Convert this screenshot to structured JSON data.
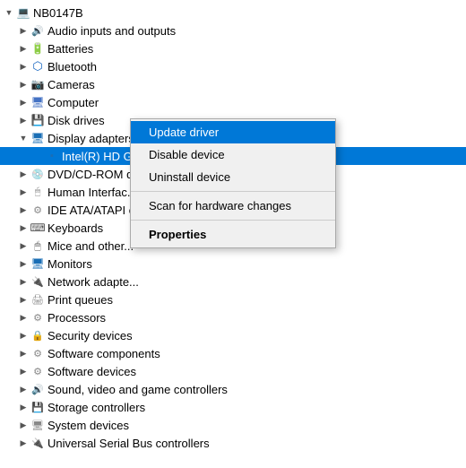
{
  "tree": {
    "items": [
      {
        "id": "root",
        "indent": 0,
        "chevron": "open",
        "icon": "💻",
        "iconClass": "ic-root",
        "label": "NB0147B",
        "selected": false
      },
      {
        "id": "audio",
        "indent": 1,
        "chevron": "closed",
        "icon": "🔊",
        "iconClass": "ic-audio",
        "label": "Audio inputs and outputs",
        "selected": false
      },
      {
        "id": "batteries",
        "indent": 1,
        "chevron": "closed",
        "icon": "🔋",
        "iconClass": "ic-battery",
        "label": "Batteries",
        "selected": false
      },
      {
        "id": "bluetooth",
        "indent": 1,
        "chevron": "closed",
        "icon": "⬡",
        "iconClass": "ic-bluetooth",
        "label": "Bluetooth",
        "selected": false
      },
      {
        "id": "cameras",
        "indent": 1,
        "chevron": "closed",
        "icon": "📷",
        "iconClass": "ic-camera",
        "label": "Cameras",
        "selected": false
      },
      {
        "id": "computer",
        "indent": 1,
        "chevron": "closed",
        "icon": "🖥",
        "iconClass": "ic-computer",
        "label": "Computer",
        "selected": false
      },
      {
        "id": "disk",
        "indent": 1,
        "chevron": "closed",
        "icon": "💾",
        "iconClass": "ic-disk",
        "label": "Disk drives",
        "selected": false
      },
      {
        "id": "display",
        "indent": 1,
        "chevron": "open",
        "icon": "🖥",
        "iconClass": "ic-display",
        "label": "Display adapters",
        "selected": false
      },
      {
        "id": "gpu",
        "indent": 2,
        "chevron": "none",
        "icon": "▪",
        "iconClass": "ic-gpu",
        "label": "Intel(R) HD Graphics 620",
        "selected": true
      },
      {
        "id": "dvd",
        "indent": 1,
        "chevron": "closed",
        "icon": "💿",
        "iconClass": "ic-dvd",
        "label": "DVD/CD-ROM d...",
        "selected": false
      },
      {
        "id": "human",
        "indent": 1,
        "chevron": "closed",
        "icon": "🖱",
        "iconClass": "ic-human",
        "label": "Human Interfac...",
        "selected": false
      },
      {
        "id": "ide",
        "indent": 1,
        "chevron": "closed",
        "icon": "⚙",
        "iconClass": "ic-ide",
        "label": "IDE ATA/ATAPI c...",
        "selected": false
      },
      {
        "id": "keyboard",
        "indent": 1,
        "chevron": "closed",
        "icon": "⌨",
        "iconClass": "ic-keyboard",
        "label": "Keyboards",
        "selected": false
      },
      {
        "id": "mice",
        "indent": 1,
        "chevron": "closed",
        "icon": "🖱",
        "iconClass": "ic-mouse",
        "label": "Mice and other...",
        "selected": false
      },
      {
        "id": "monitors",
        "indent": 1,
        "chevron": "closed",
        "icon": "🖥",
        "iconClass": "ic-monitor2",
        "label": "Monitors",
        "selected": false
      },
      {
        "id": "network",
        "indent": 1,
        "chevron": "closed",
        "icon": "🔌",
        "iconClass": "ic-network",
        "label": "Network adapte...",
        "selected": false
      },
      {
        "id": "print",
        "indent": 1,
        "chevron": "closed",
        "icon": "🖨",
        "iconClass": "ic-print",
        "label": "Print queues",
        "selected": false
      },
      {
        "id": "proc",
        "indent": 1,
        "chevron": "closed",
        "icon": "⚙",
        "iconClass": "ic-proc",
        "label": "Processors",
        "selected": false
      },
      {
        "id": "security",
        "indent": 1,
        "chevron": "closed",
        "icon": "🔒",
        "iconClass": "ic-security",
        "label": "Security devices",
        "selected": false
      },
      {
        "id": "swcomp",
        "indent": 1,
        "chevron": "closed",
        "icon": "⚙",
        "iconClass": "ic-sw",
        "label": "Software components",
        "selected": false
      },
      {
        "id": "swdev",
        "indent": 1,
        "chevron": "closed",
        "icon": "⚙",
        "iconClass": "ic-sw",
        "label": "Software devices",
        "selected": false
      },
      {
        "id": "sound",
        "indent": 1,
        "chevron": "closed",
        "icon": "🔊",
        "iconClass": "ic-sound",
        "label": "Sound, video and game controllers",
        "selected": false
      },
      {
        "id": "storage",
        "indent": 1,
        "chevron": "closed",
        "icon": "💾",
        "iconClass": "ic-storage",
        "label": "Storage controllers",
        "selected": false
      },
      {
        "id": "sysdev",
        "indent": 1,
        "chevron": "closed",
        "icon": "🖥",
        "iconClass": "ic-sysdev",
        "label": "System devices",
        "selected": false
      },
      {
        "id": "usb",
        "indent": 1,
        "chevron": "closed",
        "icon": "🔌",
        "iconClass": "ic-usb",
        "label": "Universal Serial Bus controllers",
        "selected": false
      }
    ]
  },
  "contextMenu": {
    "items": [
      {
        "id": "update-driver",
        "label": "Update driver",
        "bold": false,
        "active": true
      },
      {
        "id": "disable-device",
        "label": "Disable device",
        "bold": false,
        "active": false
      },
      {
        "id": "uninstall-device",
        "label": "Uninstall device",
        "bold": false,
        "active": false
      },
      {
        "id": "sep1",
        "type": "separator"
      },
      {
        "id": "scan-hardware",
        "label": "Scan for hardware changes",
        "bold": false,
        "active": false
      },
      {
        "id": "sep2",
        "type": "separator"
      },
      {
        "id": "properties",
        "label": "Properties",
        "bold": true,
        "active": false
      }
    ]
  }
}
